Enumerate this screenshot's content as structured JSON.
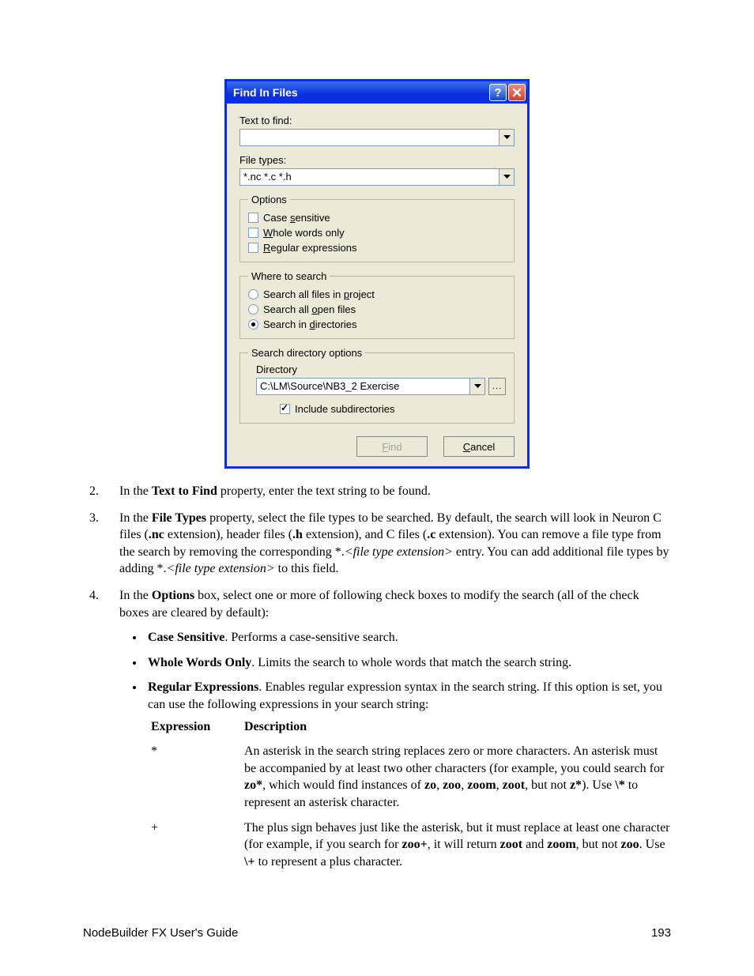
{
  "dialog": {
    "title": "Find In Files",
    "text_to_find_label": "Text to find:",
    "text_to_find_value": "",
    "file_types_label": "File types:",
    "file_types_value": "*.nc *.c *.h",
    "options_legend": "Options",
    "case_sensitive": "Case sensitive",
    "whole_words_only": "Whole words only",
    "regular_expressions": "Regular expressions",
    "where_legend": "Where to search",
    "search_project": "Search all files in project",
    "search_open": "Search all open files",
    "search_dirs": "Search in directories",
    "dir_legend": "Search directory options",
    "directory_label": "Directory",
    "directory_value": "C:\\LM\\Source\\NB3_2 Exercise",
    "include_subdirs": "Include subdirectories",
    "browse": "...",
    "find_btn": "Find",
    "cancel_btn": "Cancel"
  },
  "steps": {
    "s2_num": "2.",
    "s2_a": "In the ",
    "s2_b": "Text to Find",
    "s2_c": " property, enter the text string to be found.",
    "s3_num": "3.",
    "s3_a": "In the ",
    "s3_b": "File Types",
    "s3_c": " property, select the file types to be searched.  By default, the search will look in Neuron C files (",
    "s3_d": ".nc",
    "s3_e": " extension), header files (",
    "s3_f": ".h",
    "s3_g": " extension), and C files (",
    "s3_h": ".c",
    "s3_i": " extension).  You can remove a file type from the search by removing the corresponding *.",
    "s3_j": "<file type extension>",
    "s3_k": " entry.  You can add additional file types by adding *.",
    "s3_l": "<file type extension>",
    "s3_m": " to this field.",
    "s4_num": "4.",
    "s4_a": "In the ",
    "s4_b": "Options",
    "s4_c": " box, select one or more of following check boxes to modify the search (all of the check boxes are cleared by default):"
  },
  "bullets": {
    "cs_a": "Case Sensitive",
    "cs_b": ".  Performs a case-sensitive search.",
    "ww_a": "Whole Words Only",
    "ww_b": ".  Limits the search to whole words that match the search string.",
    "re_a": "Regular Expressions",
    "re_b": ".  Enables regular expression syntax in the search string.  If this option is set, you can use the following expressions in your search string:"
  },
  "expr": {
    "hd1": "Expression",
    "hd2": "Description",
    "star_sym": "*",
    "plus_sym": "+",
    "star_a": "An asterisk in the search string replaces zero or more characters.  An asterisk must be accompanied by at least two other characters (for example, you could search for ",
    "star_b": "zo*",
    "star_c": ", which would find instances of ",
    "star_d": "zo",
    "star_e": ", ",
    "star_f": "zoo",
    "star_g": ", ",
    "star_h": "zoom",
    "star_i": ", ",
    "star_j": "zoot",
    "star_k": ", but not ",
    "star_l": "z*",
    "star_m": ").  Use ",
    "star_n": "\\*",
    "star_o": " to represent an asterisk character.",
    "plus_a": "The plus sign behaves just like the asterisk, but it must replace at least one character (for example, if you search for ",
    "plus_b": "zoo+",
    "plus_c": ", it will return ",
    "plus_d": "zoot",
    "plus_e": " and ",
    "plus_f": "zoom",
    "plus_g": ", but not ",
    "plus_h": "zoo",
    "plus_i": ".  Use ",
    "plus_j": "\\+",
    "plus_k": " to represent a plus character."
  },
  "footer": {
    "left": "NodeBuilder FX User's Guide",
    "right": "193"
  }
}
